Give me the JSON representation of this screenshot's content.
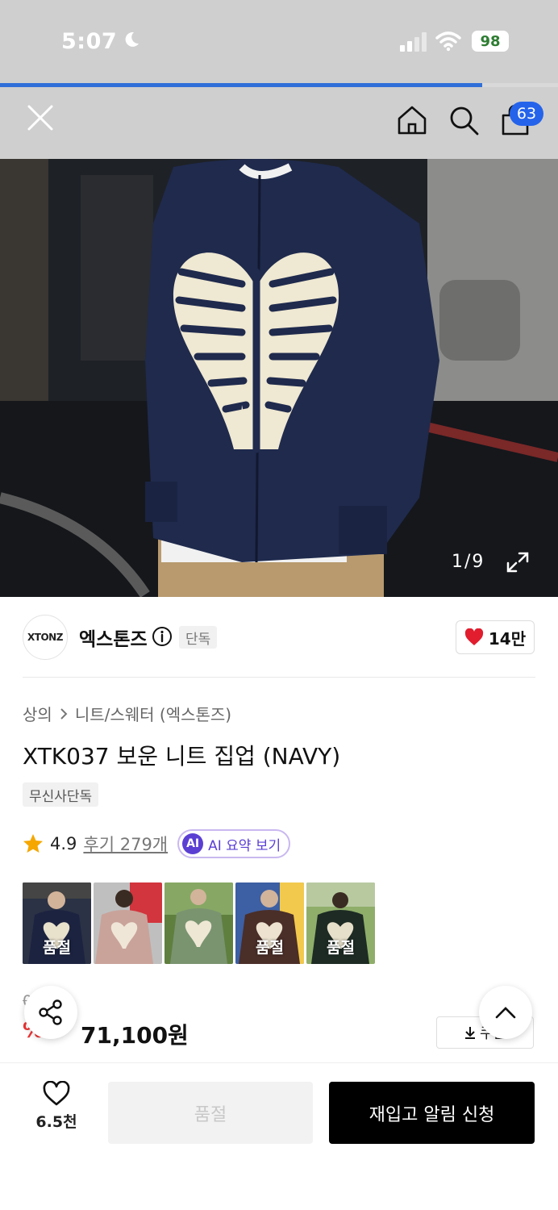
{
  "status_bar": {
    "time": "5:07",
    "battery": "98",
    "icons": [
      "moon-icon",
      "signal-icon",
      "wifi-icon",
      "battery-icon"
    ]
  },
  "top_nav": {
    "icons": [
      "close-icon",
      "home-icon",
      "search-icon",
      "cart-icon"
    ],
    "cart_count": "63"
  },
  "gallery": {
    "counter": "1/9",
    "icon": "expand-icon"
  },
  "brand": {
    "logo_text": "XTONZ",
    "name": "엑스톤즈",
    "chip": "단독",
    "likes": "14만"
  },
  "product": {
    "breadcrumb": [
      "상의",
      "니트/스웨터 (엑스톤즈)"
    ],
    "title": "XTK037 보운 니트 집업 (NAVY)",
    "tag": "무신사단독",
    "rating": "4.9",
    "reviews": "후기 279개",
    "ai_badge": "AI",
    "ai_label": "AI 요약 보기"
  },
  "thumbnails": [
    {
      "label": "품절",
      "bg": "#2b3245"
    },
    {
      "label": "",
      "bg": "#c9a39a"
    },
    {
      "label": "",
      "bg": "#6d8a55"
    },
    {
      "label": "품절",
      "bg": "#3d5fa3"
    },
    {
      "label": "품절",
      "bg": "#5f8a4a"
    }
  ],
  "price": {
    "original": "0원",
    "discount": "%",
    "sale": "71,100원",
    "coupon": "쿠폰"
  },
  "bottom": {
    "wish_count": "6.5천",
    "soldout": "품절",
    "restock": "재입고 알림 신청"
  },
  "colors": {
    "accent_blue": "#2563eb",
    "heart_red": "#e11d2e",
    "ai_purple": "#5b3fd3",
    "sweater_navy": "#1f2a4d"
  }
}
